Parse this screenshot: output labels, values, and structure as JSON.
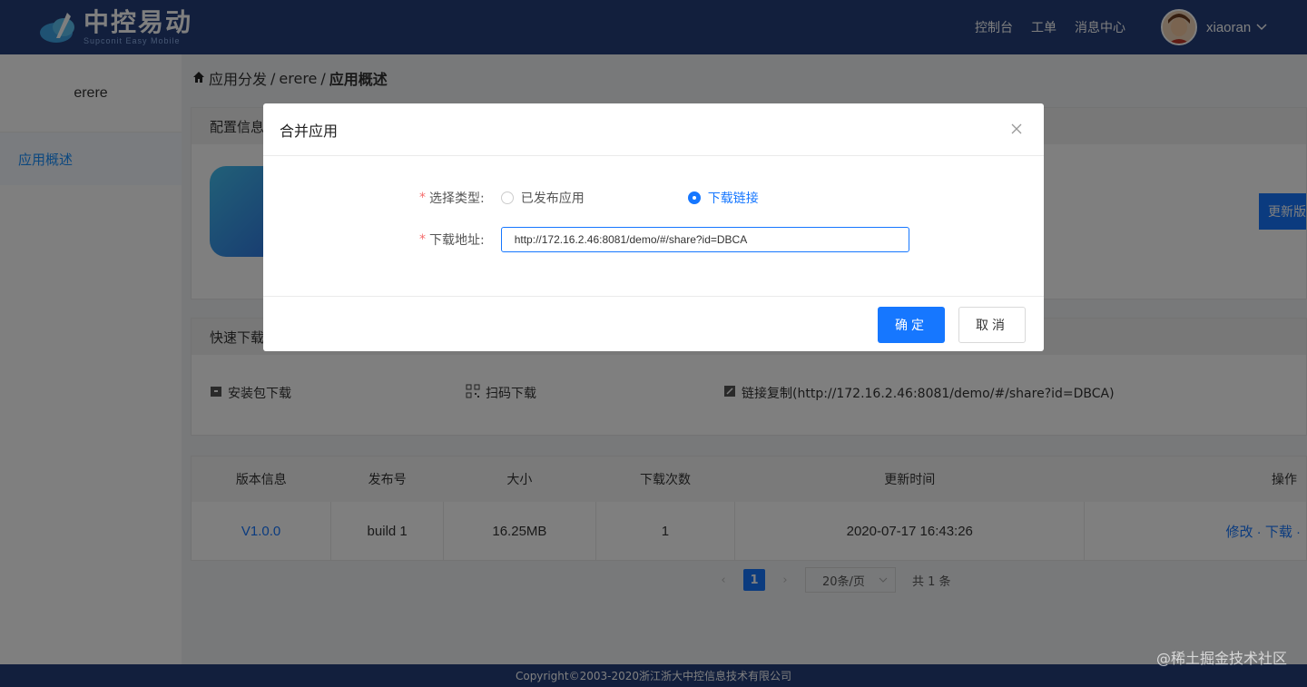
{
  "header": {
    "logo_title": "中控易动",
    "logo_sub": "Supconit Easy Mobile",
    "nav": [
      "控制台",
      "工单",
      "消息中心"
    ],
    "username": "xiaoran"
  },
  "sidebar": {
    "app_name": "erere",
    "items": [
      {
        "label": "应用概述"
      }
    ]
  },
  "breadcrumb": [
    "应用分发",
    "/",
    "erere",
    "/",
    "应用概述"
  ],
  "config_panel": {
    "title": "配置信息",
    "update_label": "更新版"
  },
  "quick_download": {
    "title": "快速下载",
    "items": [
      "安装包下载",
      "扫码下载",
      "链接复制(http://172.16.2.46:8081/demo/#/share?id=DBCA)"
    ]
  },
  "versions_table": {
    "columns": [
      "版本信息",
      "发布号",
      "大小",
      "下载次数",
      "更新时间",
      "操作"
    ],
    "rows": [
      {
        "version": "V1.0.0",
        "build": "build 1",
        "size": "16.25MB",
        "downloads": "1",
        "updated": "2020-07-17 16:43:26",
        "actions": "修改 · 下载 ·"
      }
    ]
  },
  "pagination": {
    "current": "1",
    "page_size": "20条/页",
    "total": "共 1 条"
  },
  "footer": {
    "copyright": "Copyright©2003-2020浙江浙大中控信息技术有限公司"
  },
  "watermark": "@稀土掘金技术社区",
  "modal": {
    "title": "合并应用",
    "type_label": "选择类型:",
    "type_options": [
      "已发布应用",
      "下载链接"
    ],
    "selected_type": "下载链接",
    "url_label": "下载地址:",
    "url_value": "http://172.16.2.46:8081/demo/#/share?id=DBCA",
    "ok_label": "确定",
    "cancel_label": "取消"
  },
  "colors": {
    "brand": "#243e7a",
    "accent": "#1677ff",
    "required": "#f56c6c"
  }
}
